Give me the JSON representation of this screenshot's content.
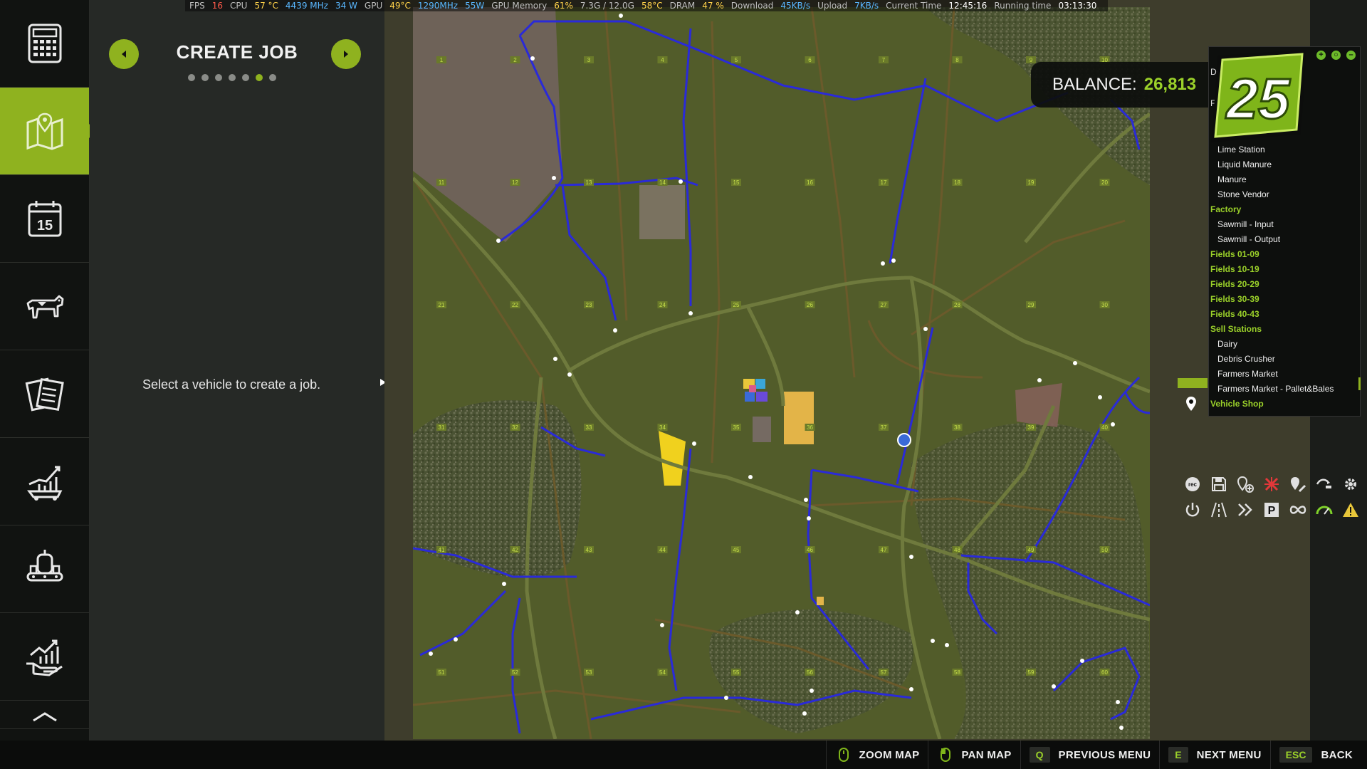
{
  "perf": {
    "fps_label": "FPS",
    "fps": "16",
    "cpu_label": "CPU",
    "cpu_temp": "57 °C",
    "cpu_clock": "4439 MHz",
    "cpu_power": "34 W",
    "gpu_label": "GPU",
    "gpu_temp": "49°C",
    "gpu_clock": "1290MHz",
    "gpu_power": "55W",
    "gpumem_label": "GPU Memory",
    "gpumem_pct": "61%",
    "gpumem_val": "7.3G / 12.0G",
    "gpumem_temp": "58°C",
    "dram_label": "DRAM",
    "dram_pct": "47 %",
    "download_label": "Download",
    "download_val": "45KB/s",
    "upload_label": "Upload",
    "upload_val": "7KB/s",
    "time_label": "Current Time",
    "time_val": "12:45:16",
    "running_label": "Running time",
    "running_val": "03:13:30"
  },
  "sidebar": {
    "items": [
      {
        "icon": "calculator-icon"
      },
      {
        "icon": "map-icon",
        "active": true
      },
      {
        "icon": "calendar-icon",
        "text": "15"
      },
      {
        "icon": "cow-icon"
      },
      {
        "icon": "documents-icon"
      },
      {
        "icon": "statistics-icon"
      },
      {
        "icon": "production-icon"
      },
      {
        "icon": "finances-icon"
      }
    ]
  },
  "panel": {
    "title": "CREATE JOB",
    "dots_total": 7,
    "dots_active_index": 5,
    "message": "Select a vehicle to create a job."
  },
  "balance": {
    "label": "BALANCE:",
    "value": "26,813"
  },
  "logo": {
    "text": "25"
  },
  "hotspots": {
    "header1": "De",
    "header2": "F",
    "list": [
      {
        "label": "Lime Station",
        "kind": "item"
      },
      {
        "label": "Liquid Manure",
        "kind": "item"
      },
      {
        "label": "Manure",
        "kind": "item"
      },
      {
        "label": "Stone Vendor",
        "kind": "item"
      },
      {
        "label": "Factory",
        "kind": "cat"
      },
      {
        "label": "Sawmill - Input",
        "kind": "item"
      },
      {
        "label": "Sawmill - Output",
        "kind": "item"
      },
      {
        "label": "Fields 01-09",
        "kind": "cat"
      },
      {
        "label": "Fields 10-19",
        "kind": "cat"
      },
      {
        "label": "Fields 20-29",
        "kind": "cat"
      },
      {
        "label": "Fields 30-39",
        "kind": "cat"
      },
      {
        "label": "Fields 40-43",
        "kind": "cat"
      },
      {
        "label": "Sell Stations",
        "kind": "cat"
      },
      {
        "label": "Dairy",
        "kind": "item"
      },
      {
        "label": "Debris Crusher",
        "kind": "item"
      },
      {
        "label": "Farmers Market",
        "kind": "item"
      },
      {
        "label": "Farmers Market - Pallet&Bales",
        "kind": "item"
      },
      {
        "label": "Vehicle Shop",
        "kind": "sel"
      }
    ]
  },
  "tools": [
    "rec-icon",
    "save-icon",
    "add-waypoint-icon",
    "remove-icon",
    "edit-waypoint-icon",
    "connect-icon",
    "settings-icon",
    "power-icon",
    "road-icon",
    "fast-forward-icon",
    "parking-icon",
    "loop-icon",
    "speed-icon",
    "warning-icon"
  ],
  "map": {
    "field_numbers": [
      "1",
      "2",
      "3",
      "4",
      "5",
      "6",
      "7",
      "8",
      "9",
      "10",
      "11",
      "12",
      "13",
      "14",
      "15",
      "16",
      "17",
      "18",
      "19",
      "20",
      "21",
      "22",
      "23",
      "24",
      "25",
      "26",
      "27",
      "28",
      "29",
      "30",
      "31",
      "32",
      "33",
      "34",
      "35",
      "36",
      "37",
      "38",
      "39",
      "40",
      "41",
      "42",
      "43",
      "44",
      "45",
      "46",
      "47",
      "48",
      "49",
      "50",
      "51",
      "52",
      "53",
      "54",
      "55",
      "56",
      "57",
      "58",
      "59",
      "60"
    ]
  },
  "colors": {
    "accent": "#8fb21f",
    "balance": "#9bd12a",
    "route": "#2a2ad8",
    "field": "#505a2a",
    "road": "#6f7a3d"
  },
  "bottom": {
    "actions": [
      {
        "key": "",
        "icon": "mouse-wheel-icon",
        "label": "ZOOM MAP"
      },
      {
        "key": "",
        "icon": "mouse-drag-icon",
        "label": "PAN MAP"
      },
      {
        "key": "Q",
        "label": "PREVIOUS MENU"
      },
      {
        "key": "E",
        "label": "NEXT MENU"
      },
      {
        "key": "ESC",
        "label": "BACK"
      }
    ]
  }
}
